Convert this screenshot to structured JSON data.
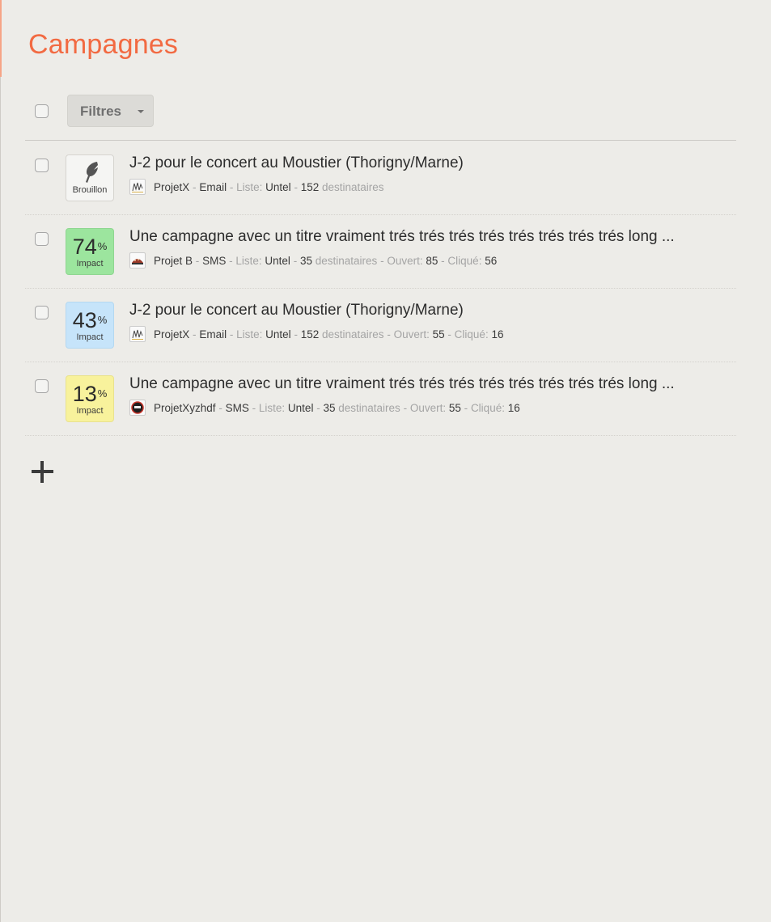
{
  "page": {
    "title": "Campagnes",
    "accent_color": "#f26a42"
  },
  "toolbar": {
    "filter_label": "Filtres"
  },
  "labels": {
    "sep": "-",
    "list": "Liste:",
    "recipients": "destinataires",
    "opened": "Ouvert:",
    "clicked": "Cliqué:",
    "impact": "Impact",
    "draft": "Brouillon",
    "percent": "%"
  },
  "campaigns": [
    {
      "status": "draft",
      "badge_icon": "feather-icon",
      "title": "J-2 pour le concert au Moustier (Thorigny/Marne)",
      "project": "ProjetX",
      "project_icon": "projetx-logo-icon",
      "channel": "Email",
      "list": "Untel",
      "recipients": "152"
    },
    {
      "status": "sent",
      "impact": "74",
      "badge_color": "#9ce59e",
      "title": "Une campagne avec un titre vraiment trés trés trés trés trés trés trés trés long ...",
      "project": "Projet B",
      "project_icon": "projet-b-logo-icon",
      "channel": "SMS",
      "list": "Untel",
      "recipients": "35",
      "opened": "85",
      "clicked": "56"
    },
    {
      "status": "sent",
      "impact": "43",
      "badge_color": "#c6e4fa",
      "title": "J-2 pour le concert au Moustier (Thorigny/Marne)",
      "project": "ProjetX",
      "project_icon": "projetx-logo-icon",
      "channel": "Email",
      "list": "Untel",
      "recipients": "152",
      "opened": "55",
      "clicked": "16"
    },
    {
      "status": "sent",
      "impact": "13",
      "badge_color": "#f8f29c",
      "title": "Une campagne avec un titre vraiment trés trés trés trés trés trés trés trés long ...",
      "project": "ProjetXyzhdf",
      "project_icon": "projetxyzhdf-logo-icon",
      "channel": "SMS",
      "list": "Untel",
      "recipients": "35",
      "opened": "55",
      "clicked": "16"
    }
  ],
  "add_button_icon": "plus-icon"
}
